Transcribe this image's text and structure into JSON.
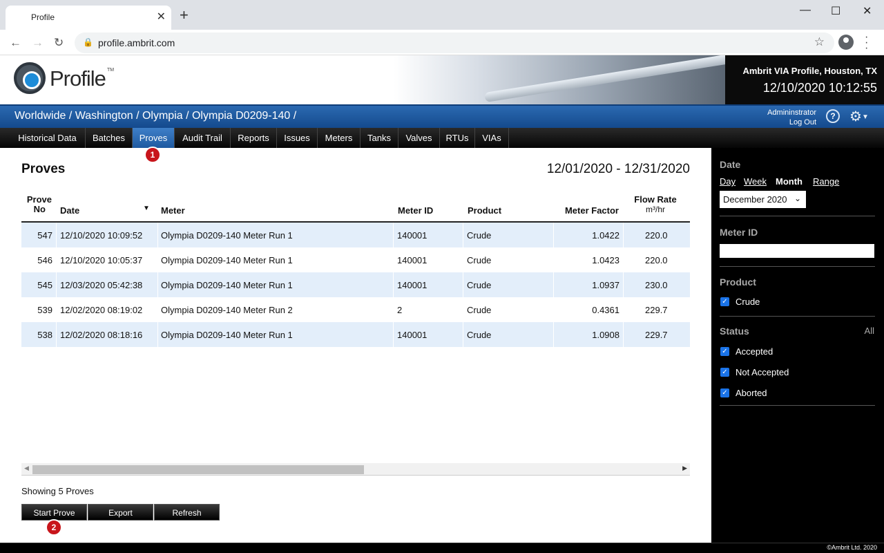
{
  "browser": {
    "tab_title": "Profile",
    "url": "profile.ambrit.com"
  },
  "header": {
    "logo_text": "Profile",
    "trademark": "TM",
    "company": "Ambrit VIA Profile, Houston, TX",
    "datetime": "12/10/2020 10:12:55"
  },
  "breadcrumb": "Worldwide / Washington / Olympia / Olympia D0209-140 /",
  "user": {
    "name": "Admininstrator",
    "logout": "Log Out",
    "help": "?"
  },
  "nav_tabs": [
    {
      "label": "Historical Data"
    },
    {
      "label": "Batches"
    },
    {
      "label": "Proves"
    },
    {
      "label": "Audit Trail"
    },
    {
      "label": "Reports"
    },
    {
      "label": "Issues"
    },
    {
      "label": "Meters"
    },
    {
      "label": "Tanks"
    },
    {
      "label": "Valves"
    },
    {
      "label": "RTUs"
    },
    {
      "label": "VIAs"
    }
  ],
  "active_tab": "Proves",
  "annotations": {
    "one": "1",
    "two": "2",
    "color": "#c8151b"
  },
  "main": {
    "title": "Proves",
    "date_range": "12/01/2020 - 12/31/2020",
    "columns": {
      "prove_no_1": "Prove",
      "prove_no_2": "No",
      "date": "Date",
      "meter": "Meter",
      "meter_id": "Meter ID",
      "product": "Product",
      "meter_factor": "Meter Factor",
      "flow_rate": "Flow Rate",
      "flow_unit": "m³/hr"
    },
    "rows": [
      {
        "prove_no": "547",
        "date": "12/10/2020 10:09:52",
        "meter": "Olympia D0209-140 Meter Run 1",
        "meter_id": "140001",
        "product": "Crude",
        "meter_factor": "1.0422",
        "flow_rate": "220.0"
      },
      {
        "prove_no": "546",
        "date": "12/10/2020 10:05:37",
        "meter": "Olympia D0209-140 Meter Run 1",
        "meter_id": "140001",
        "product": "Crude",
        "meter_factor": "1.0423",
        "flow_rate": "220.0"
      },
      {
        "prove_no": "545",
        "date": "12/03/2020 05:42:38",
        "meter": "Olympia D0209-140 Meter Run 1",
        "meter_id": "140001",
        "product": "Crude",
        "meter_factor": "1.0937",
        "flow_rate": "230.0"
      },
      {
        "prove_no": "539",
        "date": "12/02/2020 08:19:02",
        "meter": "Olympia D0209-140 Meter Run 2",
        "meter_id": "2",
        "product": "Crude",
        "meter_factor": "0.4361",
        "flow_rate": "229.7"
      },
      {
        "prove_no": "538",
        "date": "12/02/2020 08:18:16",
        "meter": "Olympia D0209-140 Meter Run 1",
        "meter_id": "140001",
        "product": "Crude",
        "meter_factor": "1.0908",
        "flow_rate": "229.7"
      }
    ],
    "count_text": "Showing 5 Proves",
    "buttons": {
      "start": "Start Prove",
      "export": "Export",
      "refresh": "Refresh"
    }
  },
  "sidebar": {
    "date_heading": "Date",
    "date_options": {
      "day": "Day",
      "week": "Week",
      "month": "Month",
      "range": "Range"
    },
    "selected_month": "December 2020",
    "meter_id_heading": "Meter ID",
    "meter_id_value": "",
    "product_heading": "Product",
    "product_options": [
      {
        "label": "Crude",
        "checked": true
      }
    ],
    "status_heading": "Status",
    "status_all": "All",
    "status_options": [
      {
        "label": "Accepted",
        "checked": true
      },
      {
        "label": "Not Accepted",
        "checked": true
      },
      {
        "label": "Aborted",
        "checked": true
      }
    ]
  },
  "footer": {
    "copyright": "©Ambrit Ltd. 2020"
  }
}
